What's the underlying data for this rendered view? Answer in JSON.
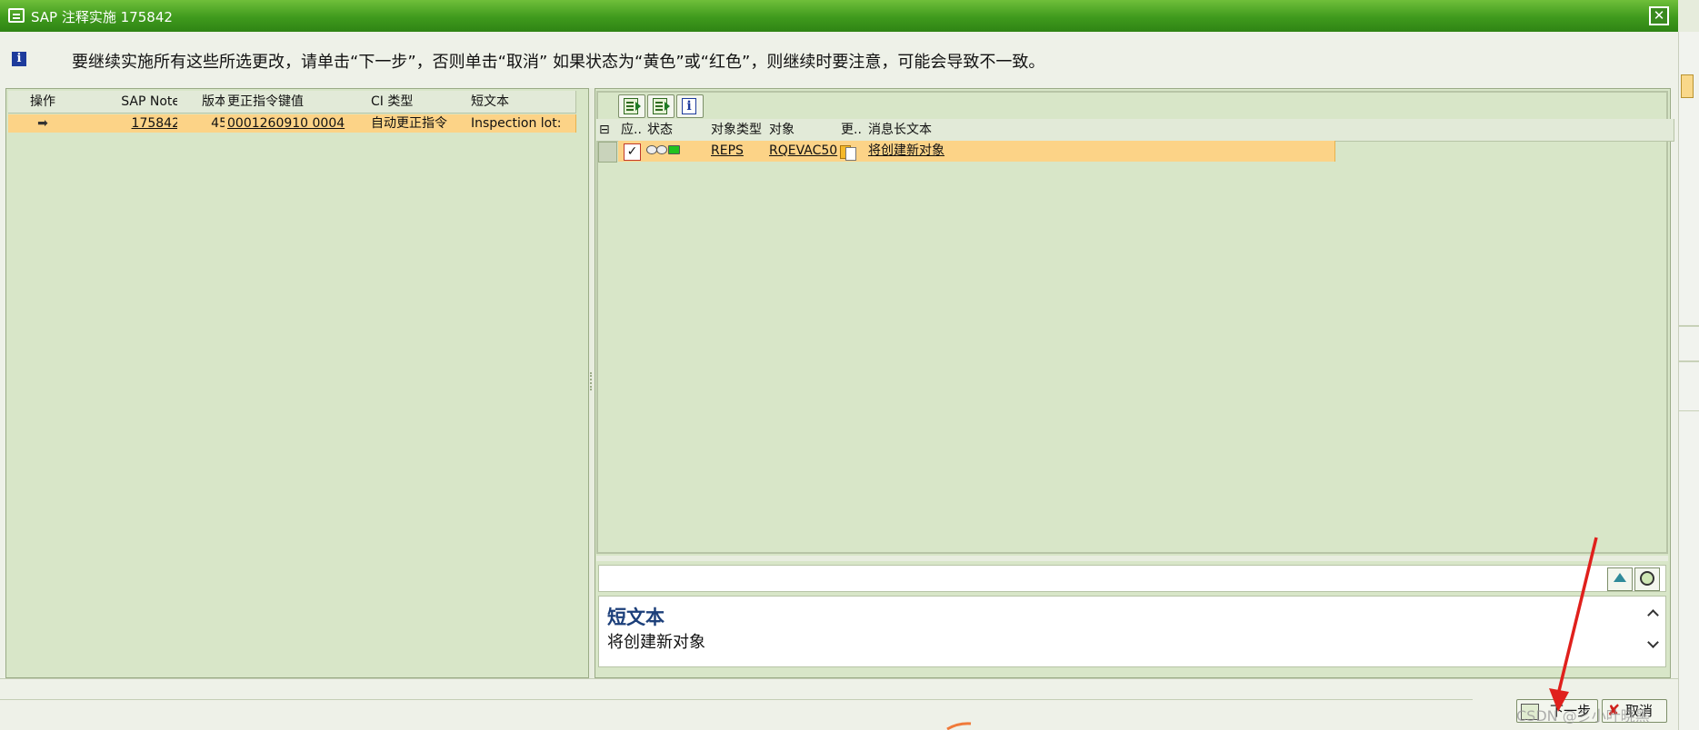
{
  "window": {
    "title": "SAP 注释实施 175842",
    "close_label": "✕"
  },
  "message": {
    "icon": "info-icon",
    "text": "要继续实施所有这些所选更改，请单击“下一步”，否则单击“取消” 如果状态为“黄色”或“红色”，则继续时要注意，可能会导致不一致。"
  },
  "left_table": {
    "columns": [
      "操作",
      "SAP Note",
      "版本",
      "更正指令键值",
      "CI 类型",
      "短文本"
    ],
    "rows": [
      {
        "action": "➡",
        "note": "175842",
        "version": "45",
        "key": "0001260910 0004",
        "ci_type": "自动更正指令",
        "short_text": "Inspection lot:"
      }
    ]
  },
  "right_table": {
    "toolbar": [
      "select-all-icon",
      "deselect-all-icon",
      "info-icon"
    ],
    "info_glyph": "i",
    "columns": [
      "应..",
      "状态",
      "对象类型",
      "对象",
      "更..",
      "消息长文本"
    ],
    "rows": [
      {
        "apply": "✓",
        "status": "traffic-light-green",
        "obj_type": "REPS",
        "object": "RQEVAC50",
        "change": "new-object-icon",
        "message": "将创建新对象"
      }
    ]
  },
  "text_panel": {
    "title": "短文本",
    "body": "将创建新对象"
  },
  "buttons": {
    "next": "下一步",
    "cancel": "取消",
    "cancel_icon": "✘"
  },
  "watermark": "CSDN @彡小叶晓黑"
}
